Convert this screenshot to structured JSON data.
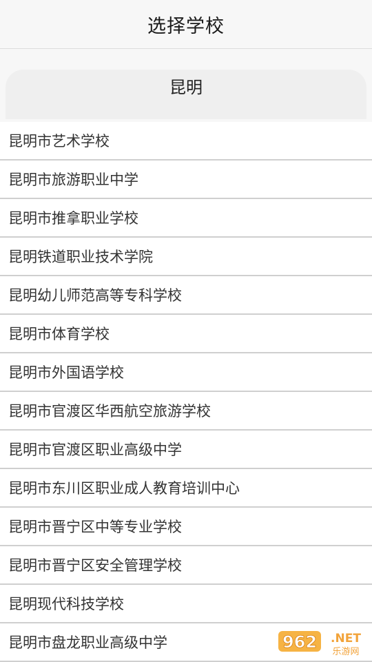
{
  "header": {
    "title": "选择学校"
  },
  "city": {
    "label": "昆明"
  },
  "schools": [
    "昆明市艺术学校",
    "昆明市旅游职业中学",
    "昆明市推拿职业学校",
    "昆明铁道职业技术学院",
    "昆明幼儿师范高等专科学校",
    "昆明市体育学校",
    "昆明市外国语学校",
    "昆明市官渡区华西航空旅游学校",
    "昆明市官渡区职业高级中学",
    "昆明市东川区职业成人教育培训中心",
    "昆明市晋宁区中等专业学校",
    "昆明市晋宁区安全管理学校",
    "昆明现代科技学校",
    "昆明市盘龙职业高级中学"
  ],
  "watermark": {
    "number": "962",
    "suffix": ".NET",
    "caption": "乐游网"
  }
}
